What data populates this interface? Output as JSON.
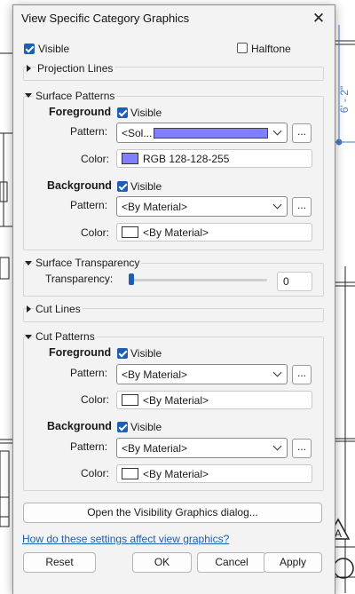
{
  "dialog": {
    "title": "View Specific Category Graphics",
    "close_glyph": "✕",
    "visible_label": "Visible",
    "halftone_label": "Halftone",
    "projection_lines": {
      "label": "Projection Lines"
    },
    "surface_patterns": {
      "label": "Surface Patterns",
      "foreground": {
        "label": "Foreground",
        "visible_label": "Visible",
        "pattern_label": "Pattern:",
        "pattern_value": "<Sol...",
        "pattern_swatch_color": "#8080ff",
        "color_label": "Color:",
        "color_value": "RGB 128-128-255",
        "color_swatch": "#8080ff"
      },
      "background": {
        "label": "Background",
        "visible_label": "Visible",
        "pattern_label": "Pattern:",
        "pattern_value": "<By Material>",
        "color_label": "Color:",
        "color_value": "<By Material>",
        "color_swatch": "#ffffff"
      }
    },
    "surface_transparency": {
      "label": "Surface Transparency",
      "transparency_label": "Transparency:",
      "value": "0"
    },
    "cut_lines": {
      "label": "Cut Lines"
    },
    "cut_patterns": {
      "label": "Cut Patterns",
      "foreground": {
        "label": "Foreground",
        "visible_label": "Visible",
        "pattern_label": "Pattern:",
        "pattern_value": "<By Material>",
        "color_label": "Color:",
        "color_value": "<By Material>"
      },
      "background": {
        "label": "Background",
        "visible_label": "Visible",
        "pattern_label": "Pattern:",
        "pattern_value": "<By Material>",
        "color_label": "Color:",
        "color_value": "<By Material>"
      }
    },
    "browse_label": "...",
    "open_vg_button": "Open the Visibility Graphics dialog...",
    "help_link": "How do these settings affect view graphics?",
    "buttons": {
      "reset": "Reset",
      "ok": "OK",
      "cancel": "Cancel",
      "apply": "Apply"
    }
  },
  "background_drawing": {
    "dimension_text": "6' - 2\"",
    "tag_letter": "A"
  }
}
